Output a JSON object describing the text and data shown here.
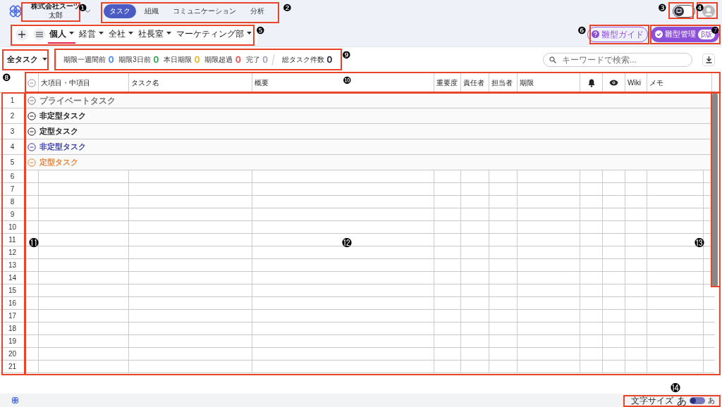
{
  "header": {
    "company": "株式会社スーツ",
    "user": "太郎",
    "nav": [
      {
        "label": "タスク",
        "selected": true
      },
      {
        "label": "組織",
        "selected": false
      },
      {
        "label": "コミュニケーション",
        "selected": false
      },
      {
        "label": "分析",
        "selected": false
      }
    ],
    "toggle": {
      "on": false
    }
  },
  "categories": [
    {
      "label": "個人",
      "selected": true
    },
    {
      "label": "経営",
      "selected": false
    },
    {
      "label": "全社",
      "selected": false
    },
    {
      "label": "社長室",
      "selected": false
    },
    {
      "label": "マーケティング部",
      "selected": false
    }
  ],
  "guide_button": "雛型ガイド",
  "manage_button": {
    "label": "雛型管理",
    "badge": "β版"
  },
  "filter": "全タスク",
  "counters": [
    {
      "label": "期限一週間前",
      "value": "0",
      "color": "#3b82f6"
    },
    {
      "label": "期限3日前",
      "value": "0",
      "color": "#22a34a"
    },
    {
      "label": "本日期限",
      "value": "0",
      "color": "#eab308"
    },
    {
      "label": "期限超過",
      "value": "0",
      "color": "#ef4444"
    },
    {
      "label": "完了",
      "value": "0",
      "color": "#9ca3af"
    },
    {
      "label": "総タスク件数",
      "value": "0",
      "color": "#111827"
    }
  ],
  "search": {
    "placeholder": "キーワードで検索..."
  },
  "table": {
    "columns": [
      {
        "kind": "text",
        "label": "大項目・中項目"
      },
      {
        "kind": "text",
        "label": "タスク名"
      },
      {
        "kind": "text",
        "label": "概要"
      },
      {
        "kind": "text",
        "label": "重要度"
      },
      {
        "kind": "text",
        "label": "責任者"
      },
      {
        "kind": "text",
        "label": "担当者"
      },
      {
        "kind": "text",
        "label": "期限"
      },
      {
        "kind": "bell"
      },
      {
        "kind": "eye"
      },
      {
        "kind": "text",
        "label": "Wiki"
      },
      {
        "kind": "text",
        "label": "メモ"
      }
    ],
    "rows": [
      {
        "number": "1",
        "kind": "group",
        "label": "プライベートタスク",
        "color": "#7a7a7a"
      },
      {
        "number": "2",
        "kind": "group",
        "label": "非定型タスク",
        "color": "#222222"
      },
      {
        "number": "3",
        "kind": "group",
        "label": "定型タスク",
        "color": "#222222"
      },
      {
        "number": "4",
        "kind": "group",
        "label": "非定型タスク",
        "color": "#4043a8"
      },
      {
        "number": "5",
        "kind": "group",
        "label": "定型タスク",
        "color": "#e8863c"
      },
      {
        "number": "6",
        "kind": "empty"
      },
      {
        "number": "7",
        "kind": "empty"
      },
      {
        "number": "8",
        "kind": "empty"
      },
      {
        "number": "9",
        "kind": "empty"
      },
      {
        "number": "10",
        "kind": "empty"
      },
      {
        "number": "11",
        "kind": "empty"
      },
      {
        "number": "12",
        "kind": "empty"
      },
      {
        "number": "13",
        "kind": "empty"
      },
      {
        "number": "14",
        "kind": "empty"
      },
      {
        "number": "15",
        "kind": "empty"
      },
      {
        "number": "16",
        "kind": "empty"
      },
      {
        "number": "17",
        "kind": "empty"
      },
      {
        "number": "18",
        "kind": "empty"
      },
      {
        "number": "19",
        "kind": "empty"
      },
      {
        "number": "20",
        "kind": "empty"
      },
      {
        "number": "21",
        "kind": "empty"
      }
    ]
  },
  "footer": {
    "label": "文字サイズ",
    "large": "あ",
    "small": "あ",
    "on": false
  },
  "callouts": [
    "❶",
    "❷",
    "❸",
    "❹",
    "❺",
    "❻",
    "❼",
    "❽",
    "❾",
    "❿",
    "⓫",
    "⓬",
    "⓭",
    "⓮"
  ]
}
